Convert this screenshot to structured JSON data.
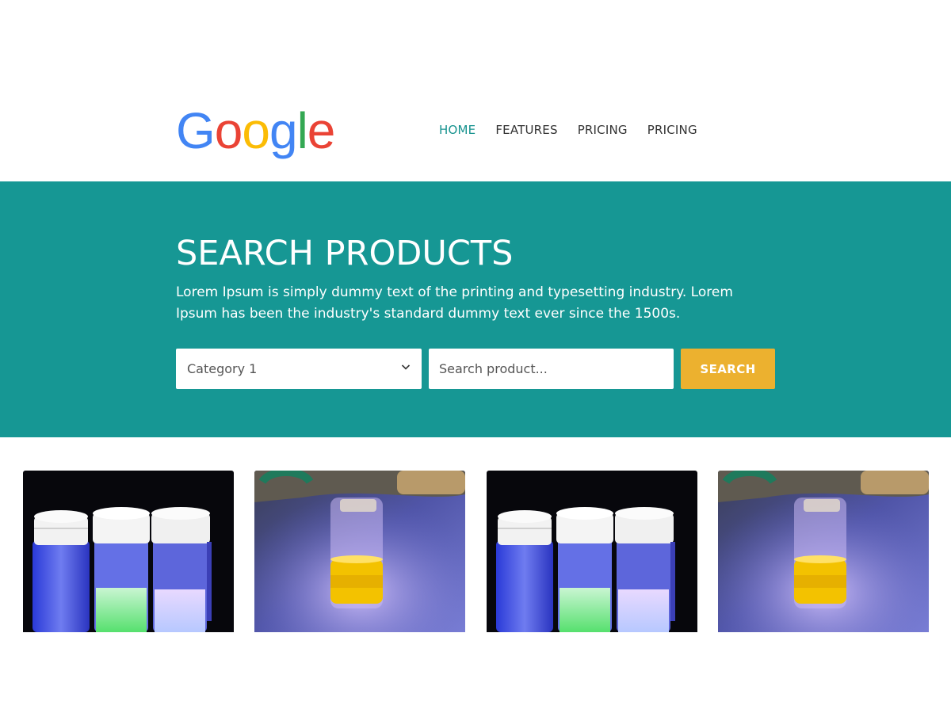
{
  "brand": {
    "logo_text": [
      "G",
      "o",
      "o",
      "g",
      "l",
      "e"
    ],
    "logo_colors": [
      "#4285F4",
      "#EA4335",
      "#FBBC05",
      "#4285F4",
      "#34A853",
      "#EA4335"
    ]
  },
  "nav": {
    "items": [
      {
        "label": "HOME",
        "active": true
      },
      {
        "label": "FEATURES",
        "active": false
      },
      {
        "label": "PRICING",
        "active": false
      },
      {
        "label": "PRICING",
        "active": false
      }
    ]
  },
  "hero": {
    "title": "SEARCH PRODUCTS",
    "description": "Lorem Ipsum is simply dummy text of the printing and typesetting industry. Lorem Ipsum has been the industry's standard dummy text ever since the 1500s.",
    "category_select": {
      "selected": "Category 1"
    },
    "search": {
      "placeholder": "Search product..."
    },
    "search_button": "SEARCH"
  },
  "colors": {
    "accent": "#169794",
    "button": "#ECB12F",
    "nav_active": "#17938F"
  },
  "products": [
    {
      "image": "three-vials-fluorescent"
    },
    {
      "image": "single-vial-yellow"
    },
    {
      "image": "three-vials-fluorescent"
    },
    {
      "image": "single-vial-yellow"
    }
  ]
}
